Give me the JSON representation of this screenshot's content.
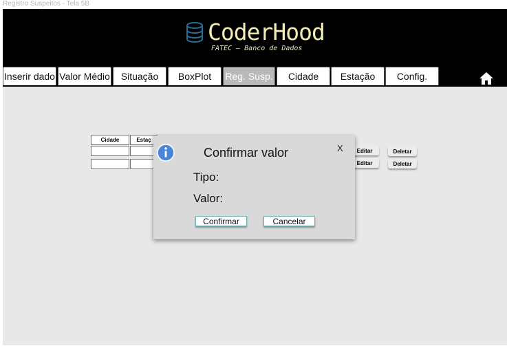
{
  "frame": {
    "label": "Registro Suspeitos - Tela 5B"
  },
  "header": {
    "title": "CoderHood",
    "subtitle": "FATEC – Banco de Dados",
    "logo_icon": "database-icon",
    "home_icon": "home-icon"
  },
  "tabs": [
    {
      "label": "Inserir dado",
      "active": false
    },
    {
      "label": "Valor Médio",
      "active": false
    },
    {
      "label": "Situação",
      "active": false
    },
    {
      "label": "BoxPlot",
      "active": false
    },
    {
      "label": "Reg. Susp.",
      "active": true
    },
    {
      "label": "Cidade",
      "active": false
    },
    {
      "label": "Estação",
      "active": false
    },
    {
      "label": "Config.",
      "active": false
    }
  ],
  "table": {
    "headers": [
      "Cidade",
      "Estaç"
    ],
    "rows": [
      [
        "",
        ""
      ],
      [
        "",
        ""
      ]
    ],
    "edit_label": "Editar",
    "delete_label": "Deletar"
  },
  "modal": {
    "title": "Confirmar valor",
    "close": "X",
    "fields": [
      "Tipo:",
      "Valor:"
    ],
    "confirm": "Confirmar",
    "cancel": "Cancelar",
    "icon": "info-icon"
  },
  "colors": {
    "header_bg": "#000000",
    "logo_text": "#f3efb4",
    "active_tab": "#b9b9b9",
    "info_blue": "#4a86d8",
    "screen_bg": "#e8e8e8"
  }
}
